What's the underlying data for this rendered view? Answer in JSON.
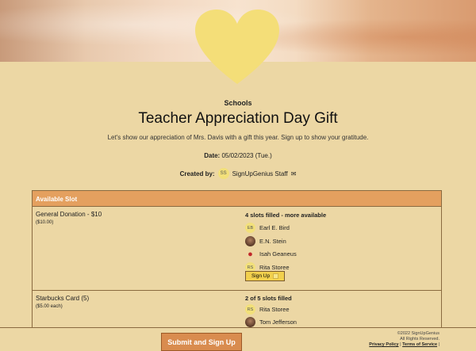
{
  "header": {
    "category": "Schools",
    "title": "Teacher Appreciation Day Gift",
    "description": "Let's show our appreciation of Mrs. Davis with a gift this year. Sign up to show your gratitude.",
    "date_label": "Date:",
    "date_value": "05/02/2023 (Tue.)",
    "created_label": "Created by:",
    "creator_initials": "SS",
    "creator_name": "SignUpGenius Staff",
    "mail_icon": "mail-icon"
  },
  "table": {
    "header": "Available Slot",
    "slots": [
      {
        "name": "General Donation - $10",
        "price": "($10.00)",
        "status": "4 slots filled - more available",
        "people": [
          {
            "initials": "EB",
            "name": "Earl E. Bird",
            "avatar": "initials"
          },
          {
            "initials": "",
            "name": "E.N. Stein",
            "avatar": "photo"
          },
          {
            "initials": "",
            "name": "Isah Geaneus",
            "avatar": "apple-icon"
          },
          {
            "initials": "RS",
            "name": "Rita Storee",
            "avatar": "initials"
          }
        ],
        "signup_label": "Sign Up"
      },
      {
        "name": "Starbucks Card (5)",
        "price": "($5.00 each)",
        "status": "2 of 5 slots filled",
        "people": [
          {
            "initials": "RS",
            "name": "Rita Storee",
            "avatar": "initials"
          },
          {
            "initials": "",
            "name": "Tom Jefferson",
            "avatar": "photo"
          }
        ]
      }
    ]
  },
  "footer": {
    "submit_label": "Submit and Sign Up",
    "copyright": "©2022 SignUpGenius",
    "rights": "All Rights Reserved.",
    "privacy": "Privacy Policy",
    "terms": "Terms of Service"
  },
  "colors": {
    "background": "#ecd7a4",
    "heart": "#f4de78",
    "table_header": "#e4a05f",
    "submit_button": "#d98c4f",
    "signup_button": "#f2d04d"
  }
}
